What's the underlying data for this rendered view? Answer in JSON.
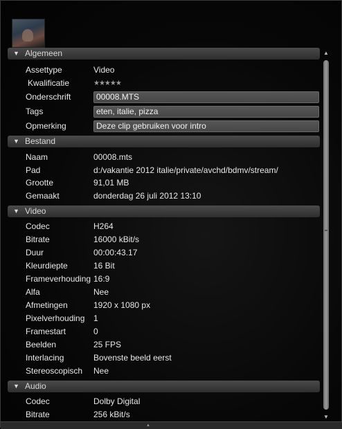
{
  "sections": [
    {
      "title": "Algemeen",
      "rows": [
        {
          "label": "Assettype",
          "value": "Video"
        },
        {
          "label": "Kwalificatie",
          "value": "★★★★★"
        },
        {
          "label": "Onderschrift",
          "value": "00008.MTS"
        },
        {
          "label": "Tags",
          "value": "eten, italie, pizza"
        },
        {
          "label": "Opmerking",
          "value": "Deze clip gebruiken voor intro"
        }
      ]
    },
    {
      "title": "Bestand",
      "rows": [
        {
          "label": "Naam",
          "value": "00008.mts"
        },
        {
          "label": "Pad",
          "value": "d:/vakantie 2012 italie/private/avchd/bdmv/stream/"
        },
        {
          "label": "Grootte",
          "value": "91,01 MB"
        },
        {
          "label": "Gemaakt",
          "value": "donderdag 26 juli 2012 13:10"
        }
      ]
    },
    {
      "title": "Video",
      "rows": [
        {
          "label": "Codec",
          "value": "H264"
        },
        {
          "label": "Bitrate",
          "value": "16000 kBit/s"
        },
        {
          "label": "Duur",
          "value": "00:00:43.17"
        },
        {
          "label": "Kleurdiepte",
          "value": "16 Bit"
        },
        {
          "label": "Frameverhouding",
          "value": "16:9"
        },
        {
          "label": "Alfa",
          "value": "Nee"
        },
        {
          "label": "Afmetingen",
          "value": "1920 x 1080 px"
        },
        {
          "label": "Pixelverhouding",
          "value": "1"
        },
        {
          "label": "Framestart",
          "value": "0"
        },
        {
          "label": "Beelden",
          "value": "25 FPS"
        },
        {
          "label": "Interlacing",
          "value": "Bovenste beeld eerst"
        },
        {
          "label": "Stereoscopisch",
          "value": "Nee"
        }
      ]
    },
    {
      "title": "Audio",
      "rows": [
        {
          "label": "Codec",
          "value": "Dolby Digital"
        },
        {
          "label": "Bitrate",
          "value": "256 kBit/s"
        }
      ]
    }
  ],
  "icons": {
    "collapse": "triangle-down-icon",
    "scroll_up": "arrow-up-icon",
    "scroll_down": "arrow-down-icon"
  }
}
